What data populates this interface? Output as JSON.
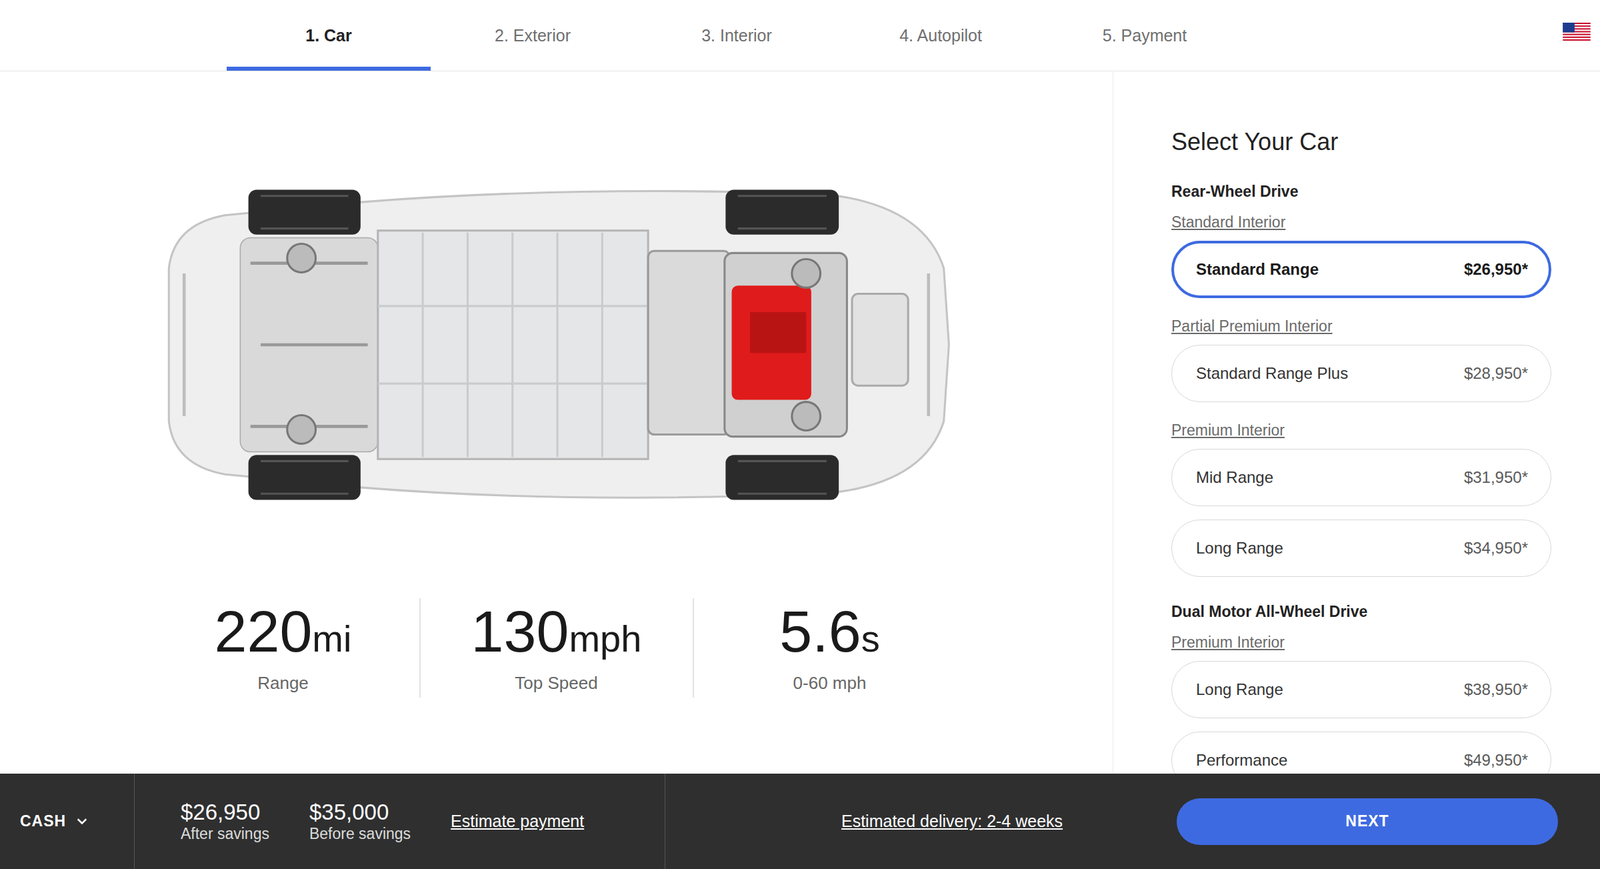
{
  "tabs": [
    {
      "label": "1. Car",
      "selected": true
    },
    {
      "label": "2. Exterior",
      "selected": false
    },
    {
      "label": "3. Interior",
      "selected": false
    },
    {
      "label": "4. Autopilot",
      "selected": false
    },
    {
      "label": "5. Payment",
      "selected": false
    }
  ],
  "stats": [
    {
      "value": "220",
      "unit": "mi",
      "label": "Range"
    },
    {
      "value": "130",
      "unit": "mph",
      "label": "Top Speed"
    },
    {
      "value": "5.6",
      "unit": "s",
      "label": "0-60 mph"
    }
  ],
  "panel": {
    "title": "Select Your Car",
    "groups": [
      {
        "title": "Rear-Wheel Drive",
        "sections": [
          {
            "label": "Standard Interior",
            "options": [
              {
                "name": "Standard Range",
                "price": "$26,950*",
                "selected": true
              }
            ]
          },
          {
            "label": "Partial Premium Interior",
            "options": [
              {
                "name": "Standard Range Plus",
                "price": "$28,950*",
                "selected": false
              }
            ]
          },
          {
            "label": "Premium Interior",
            "options": [
              {
                "name": "Mid Range",
                "price": "$31,950*",
                "selected": false
              },
              {
                "name": "Long Range",
                "price": "$34,950*",
                "selected": false
              }
            ]
          }
        ]
      },
      {
        "title": "Dual Motor All-Wheel Drive",
        "sections": [
          {
            "label": "Premium Interior",
            "options": [
              {
                "name": "Long Range",
                "price": "$38,950*",
                "selected": false
              },
              {
                "name": "Performance",
                "price": "$49,950*",
                "selected": false
              }
            ]
          }
        ]
      }
    ]
  },
  "bottom_bar": {
    "payment_type": "CASH",
    "prices": [
      {
        "amount": "$26,950",
        "label": "After savings"
      },
      {
        "amount": "$35,000",
        "label": "Before savings"
      }
    ],
    "estimate_link": "Estimate payment",
    "delivery": "Estimated delivery: 2-4 weeks",
    "next_button": "NEXT"
  }
}
